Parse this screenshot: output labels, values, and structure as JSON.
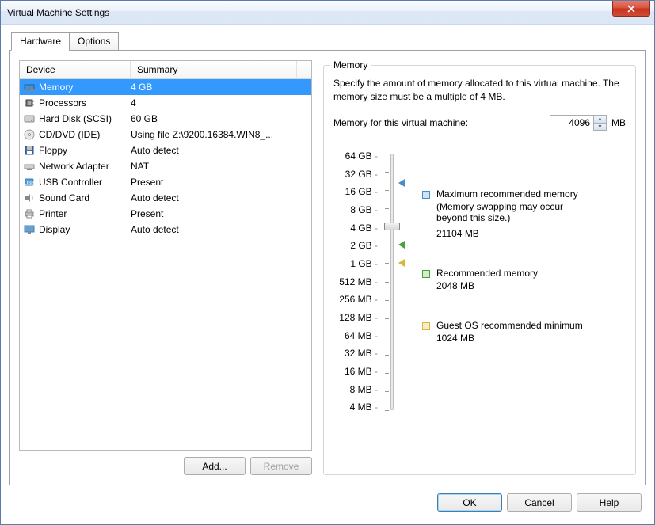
{
  "window": {
    "title": "Virtual Machine Settings"
  },
  "tabs": {
    "hardware": "Hardware",
    "options": "Options",
    "active": "hardware"
  },
  "list": {
    "head_device": "Device",
    "head_summary": "Summary",
    "rows": [
      {
        "icon": "memory",
        "label": "Memory",
        "summary": "4 GB",
        "selected": true
      },
      {
        "icon": "cpu",
        "label": "Processors",
        "summary": "4"
      },
      {
        "icon": "hdd",
        "label": "Hard Disk (SCSI)",
        "summary": "60 GB"
      },
      {
        "icon": "cd",
        "label": "CD/DVD (IDE)",
        "summary": "Using file Z:\\9200.16384.WIN8_..."
      },
      {
        "icon": "floppy",
        "label": "Floppy",
        "summary": "Auto detect"
      },
      {
        "icon": "net",
        "label": "Network Adapter",
        "summary": "NAT"
      },
      {
        "icon": "usb",
        "label": "USB Controller",
        "summary": "Present"
      },
      {
        "icon": "sound",
        "label": "Sound Card",
        "summary": "Auto detect"
      },
      {
        "icon": "printer",
        "label": "Printer",
        "summary": "Present"
      },
      {
        "icon": "display",
        "label": "Display",
        "summary": "Auto detect"
      }
    ]
  },
  "buttons": {
    "add": "Add...",
    "remove": "Remove",
    "ok": "OK",
    "cancel": "Cancel",
    "help": "Help"
  },
  "memory": {
    "group_title": "Memory",
    "description": "Specify the amount of memory allocated to this virtual machine. The memory size must be a multiple of 4 MB.",
    "label_prefix": "Memory for this virtual ",
    "label_underline": "m",
    "label_suffix": "achine:",
    "value": "4096",
    "unit": "MB",
    "ticks": [
      "64 GB",
      "32 GB",
      "16 GB",
      "8 GB",
      "4 GB",
      "2 GB",
      "1 GB",
      "512 MB",
      "256 MB",
      "128 MB",
      "64 MB",
      "32 MB",
      "16 MB",
      "8 MB",
      "4 MB"
    ],
    "legend": {
      "max_label": "Maximum recommended memory",
      "max_note": "(Memory swapping may occur beyond this size.)",
      "max_value": "21104 MB",
      "rec_label": "Recommended memory",
      "rec_value": "2048 MB",
      "min_label": "Guest OS recommended minimum",
      "min_value": "1024 MB"
    }
  }
}
